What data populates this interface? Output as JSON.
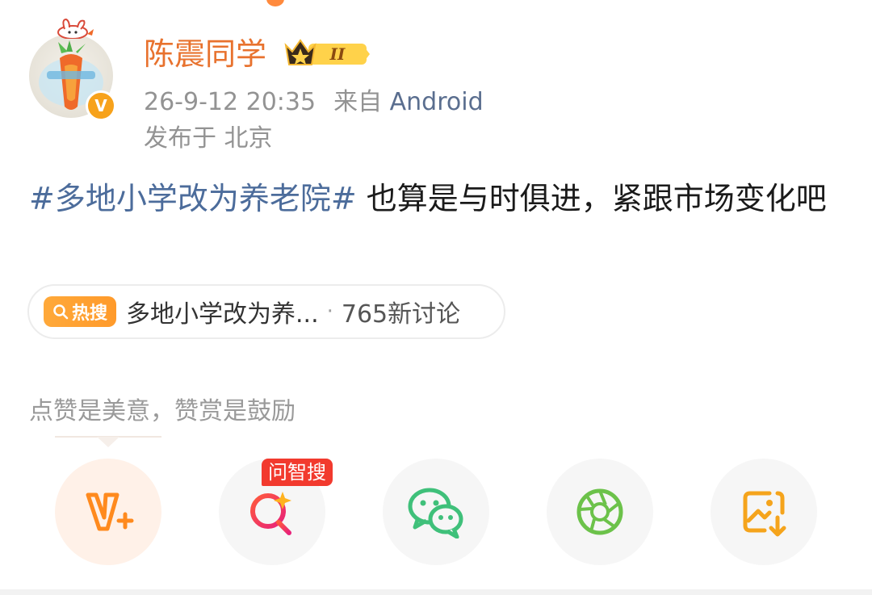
{
  "colors": {
    "username": "#e8722e",
    "hashtag": "#4c6c9b",
    "source": "#5a6e8f",
    "meta": "#939393",
    "accent_orange": "#ff8200",
    "hot_tag": "#ffa93a",
    "ai_badge": "#f23a2e",
    "wechat_green": "#3fc07a",
    "moments_green": "#6cc24a"
  },
  "post": {
    "author": {
      "name": "陈震同学",
      "verified_symbol": "V",
      "vip_level": "II"
    },
    "meta": {
      "time": "26-9-12 20:35",
      "from_label": "来自",
      "source": "Android",
      "location": "发布于 北京"
    },
    "text": {
      "hashtag": "#多地小学改为养老院#",
      "body": " 也算是与时俱进，紧跟市场变化吧"
    },
    "hot_search": {
      "tag_label": "热搜",
      "topic": "多地小学改为养...",
      "separator": "·",
      "count": "765新讨论"
    },
    "reward_prompt": "点赞是美意，赞赏是鼓励"
  },
  "actions": [
    {
      "icon": "reward-v-plus-icon"
    },
    {
      "icon": "ai-search-icon",
      "badge": "问智搜"
    },
    {
      "icon": "wechat-icon"
    },
    {
      "icon": "moments-icon"
    },
    {
      "icon": "save-image-icon"
    }
  ]
}
